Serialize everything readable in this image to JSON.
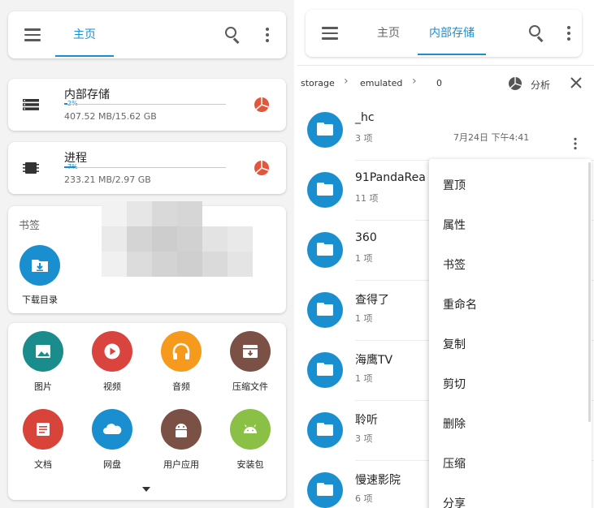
{
  "colors": {
    "accent": "#1a8fd0",
    "pie": "#e5553a",
    "divider": "#ececec"
  },
  "left": {
    "menu_icon": "hamburger-icon",
    "home_tab": "主页",
    "storage": [
      {
        "title": "内部存储",
        "percent": 2,
        "percent_label": "2%",
        "detail": "407.52 MB/15.62 GB",
        "icon": "storage-icon"
      },
      {
        "title": "进程",
        "percent": 7,
        "percent_label": "7%",
        "detail": "233.21 MB/2.97 GB",
        "icon": "chip-icon"
      }
    ],
    "bookmarks": {
      "title": "书签",
      "items": [
        {
          "label": "下载目录",
          "icon": "download-folder-icon"
        }
      ]
    },
    "categories": [
      {
        "label": "图片",
        "color": "#1b8c8c",
        "icon": "image-icon"
      },
      {
        "label": "视频",
        "color": "#d9443f",
        "icon": "play-icon"
      },
      {
        "label": "音频",
        "color": "#f59a1c",
        "icon": "headphones-icon"
      },
      {
        "label": "压缩文件",
        "color": "#7b5146",
        "icon": "archive-icon"
      },
      {
        "label": "文档",
        "color": "#d8443a",
        "icon": "document-icon"
      },
      {
        "label": "网盘",
        "color": "#1a8fd0",
        "icon": "cloud-icon"
      },
      {
        "label": "用户应用",
        "color": "#7b5146",
        "icon": "android-icon"
      },
      {
        "label": "安装包",
        "color": "#8ac045",
        "icon": "android-icon"
      }
    ]
  },
  "right": {
    "tabs": [
      {
        "label": "主页"
      },
      {
        "label": "内部存储"
      }
    ],
    "breadcrumb": [
      "storage",
      "emulated",
      "0"
    ],
    "analyze_label": "分析",
    "files": [
      {
        "name": "_hc",
        "count": "3 项",
        "date": "7月24日 下午4:41"
      },
      {
        "name": "91PandaRea",
        "count": "11 项",
        "date": ""
      },
      {
        "name": "360",
        "count": "1 项",
        "date": ""
      },
      {
        "name": "查得了",
        "count": "1 项",
        "date": ""
      },
      {
        "name": "海鹰TV",
        "count": "1 项",
        "date": ""
      },
      {
        "name": "聆听",
        "count": "3 项",
        "date": ""
      },
      {
        "name": "慢速影院",
        "count": "6 项",
        "date": ""
      }
    ],
    "context_menu": [
      "置顶",
      "属性",
      "书签",
      "重命名",
      "复制",
      "剪切",
      "删除",
      "压缩",
      "分享"
    ]
  }
}
